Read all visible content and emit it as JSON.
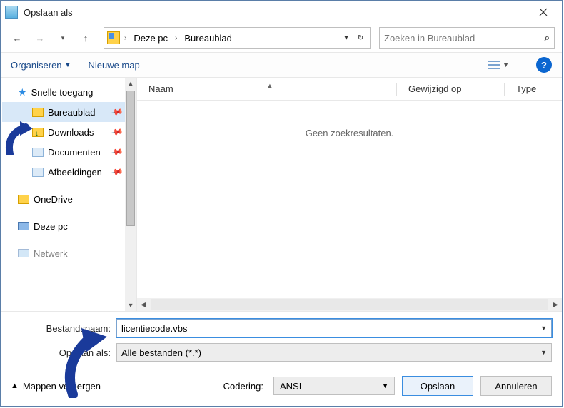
{
  "title": "Opslaan als",
  "breadcrumb": {
    "root": "Deze pc",
    "current": "Bureaublad"
  },
  "search": {
    "placeholder": "Zoeken in Bureaublad"
  },
  "toolbar": {
    "organize": "Organiseren",
    "new_folder": "Nieuwe map"
  },
  "sidebar": {
    "quick_access": "Snelle toegang",
    "desktop": "Bureaublad",
    "downloads": "Downloads",
    "documents": "Documenten",
    "pictures": "Afbeeldingen",
    "onedrive": "OneDrive",
    "this_pc": "Deze pc",
    "network": "Netwerk"
  },
  "columns": {
    "name": "Naam",
    "modified": "Gewijzigd op",
    "type": "Type"
  },
  "empty_message": "Geen zoekresultaten.",
  "form": {
    "filename_label": "Bestandsnaam:",
    "filename_value": "licentiecode.vbs",
    "saveas_label": "Opslaan als:",
    "saveas_value": "Alle bestanden  (*.*)"
  },
  "footer": {
    "hide_folders": "Mappen verbergen",
    "encoding_label": "Codering:",
    "encoding_value": "ANSI",
    "save": "Opslaan",
    "cancel": "Annuleren"
  },
  "help_icon_text": "?"
}
